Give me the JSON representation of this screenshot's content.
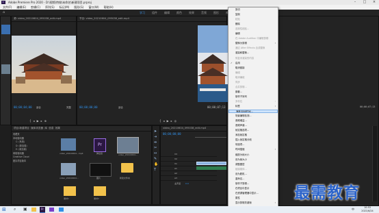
{
  "app": {
    "title": "Adobe Premiere Pro 2020 - D:\\视频\\特效\\未命名\\新建项目.prproj",
    "menu": [
      "文件(F)",
      "编辑(E)",
      "剪辑(C)",
      "序列(S)",
      "标记(M)",
      "图形(G)",
      "窗口(W)",
      "帮助(H)"
    ],
    "workspaces": [
      "学习",
      "组件",
      "编辑",
      "颜色",
      "效果",
      "音频",
      "图形",
      "库"
    ]
  },
  "source_monitor": {
    "tab": "源: video_20210604_095038_edit.mp4",
    "timecode": "00;00;04;00",
    "fit": "适合",
    "quality": "完整",
    "end_timecode": "00;00;04;00"
  },
  "program_monitor": {
    "tab": "节目: video_20210604_095038_edit.mp4",
    "timecode": "00;00;00;00",
    "fit": "适合",
    "end_timecode": "00;00;07;13"
  },
  "project_panel": {
    "tabs": [
      "项目:新建项目",
      "媒体浏览器",
      "库",
      "信息",
      "效果",
      "标记",
      "历史记录"
    ],
    "tree": [
      "收藏夹",
      "本地驱动器",
      "C: (系统)",
      "D: (新加卷)",
      "E: (新加卷)",
      "网络驱动器",
      "Creative Cloud",
      "团队项目版本"
    ],
    "items": [
      {
        "name": "video_20210604...mp4"
      },
      {
        "name": "弹出窗",
        "type": "Pr"
      },
      {
        "name": "video_20210604..."
      },
      {
        "name": "video_20210604..."
      },
      {
        "name": "图片"
      },
      {
        "name": "新建文件夹"
      },
      {
        "name": "素材1"
      },
      {
        "name": "素材2"
      }
    ]
  },
  "timeline": {
    "tab": "video_20210604_095038_edit.mp4",
    "timecode": "00;00;00;00",
    "tracks": [
      "V3",
      "V2",
      "V1",
      "A1",
      "A2",
      "A3"
    ],
    "master": "主声道",
    "master_value": "0.0"
  },
  "context_menu": {
    "items": [
      {
        "label": "剪切",
        "enabled": true
      },
      {
        "label": "复制",
        "enabled": true
      },
      {
        "label": "粘贴",
        "enabled": false
      },
      {
        "label": "删除",
        "enabled": true
      },
      {
        "label": "选择性粘贴...",
        "enabled": false
      },
      {
        "label": "编辑",
        "enabled": true
      },
      {
        "label": "在 Adobe Audition 中编辑剪辑",
        "enabled": false
      },
      {
        "label": "替换为剪辑",
        "enabled": true,
        "submenu": true
      },
      {
        "label": "通过 After Effects 合成替换",
        "enabled": false
      },
      {
        "label": "渲染和替换...",
        "enabled": true
      },
      {
        "label": "恢复未渲染的内容",
        "enabled": false
      },
      {
        "label": "启用",
        "enabled": true,
        "checked": true
      },
      {
        "label": "取消链接",
        "enabled": true
      },
      {
        "label": "编组",
        "enabled": false
      },
      {
        "label": "取消编组",
        "enabled": false
      },
      {
        "label": "同步",
        "enabled": false
      },
      {
        "label": "合并剪辑...",
        "enabled": false
      },
      {
        "label": "嵌套...",
        "enabled": true
      },
      {
        "label": "制作子序列",
        "enabled": true
      },
      {
        "label": "多机位",
        "enabled": false,
        "submenu": true
      },
      {
        "label": "标签",
        "enabled": true,
        "submenu": true
      },
      {
        "label": "速度/持续时间...",
        "enabled": true,
        "highlighted": true
      },
      {
        "label": "场景编辑检测...",
        "enabled": true
      },
      {
        "label": "音频增益...",
        "enabled": true
      },
      {
        "label": "音频声道...",
        "enabled": true
      },
      {
        "label": "帧定格选项...",
        "enabled": true
      },
      {
        "label": "添加帧定格",
        "enabled": true
      },
      {
        "label": "插入帧定格分段",
        "enabled": true
      },
      {
        "label": "场选项...",
        "enabled": true
      },
      {
        "label": "时间插值",
        "enabled": true,
        "submenu": true
      },
      {
        "label": "缩放为帧大小",
        "enabled": true
      },
      {
        "label": "设为帧大小",
        "enabled": true
      },
      {
        "label": "调整图层",
        "enabled": true
      },
      {
        "label": "链接媒体...",
        "enabled": false
      },
      {
        "label": "设为脱机...",
        "enabled": true
      },
      {
        "label": "重命名...",
        "enabled": true
      },
      {
        "label": "制作子剪辑...",
        "enabled": true
      },
      {
        "label": "在项目中显示",
        "enabled": true
      },
      {
        "label": "在资源管理器中显示...",
        "enabled": true
      },
      {
        "label": "属性",
        "enabled": true
      },
      {
        "label": "显示剪辑关键帧",
        "enabled": true,
        "submenu": true
      }
    ]
  },
  "watermark": "最需教育",
  "taskbar": {
    "time": "10:53",
    "date": "2021/6/24",
    "lang": "中"
  },
  "colors": {
    "accent": "#2f8fe8",
    "menu_highlight": "#cfe4fb",
    "watermark": "#2b63c9"
  }
}
